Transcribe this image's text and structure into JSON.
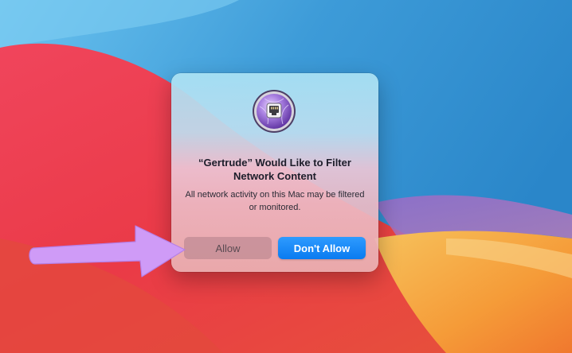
{
  "dialog": {
    "title": "“Gertrude” Would Like to Filter Network Content",
    "message": "All network activity on this Mac may be filtered or monitored.",
    "app_icon": "network-filter-app-icon",
    "buttons": {
      "allow_label": "Allow",
      "deny_label": "Don't Allow"
    }
  },
  "annotation": {
    "arrow_icon": "pointer-arrow-icon",
    "arrow_color": "#cf9bf7"
  },
  "colors": {
    "accent": "#0a7bf0",
    "wallpaper_red": "#ec3f4f",
    "wallpaper_blue": "#3a9ad6",
    "wallpaper_orange": "#f49a3a"
  }
}
